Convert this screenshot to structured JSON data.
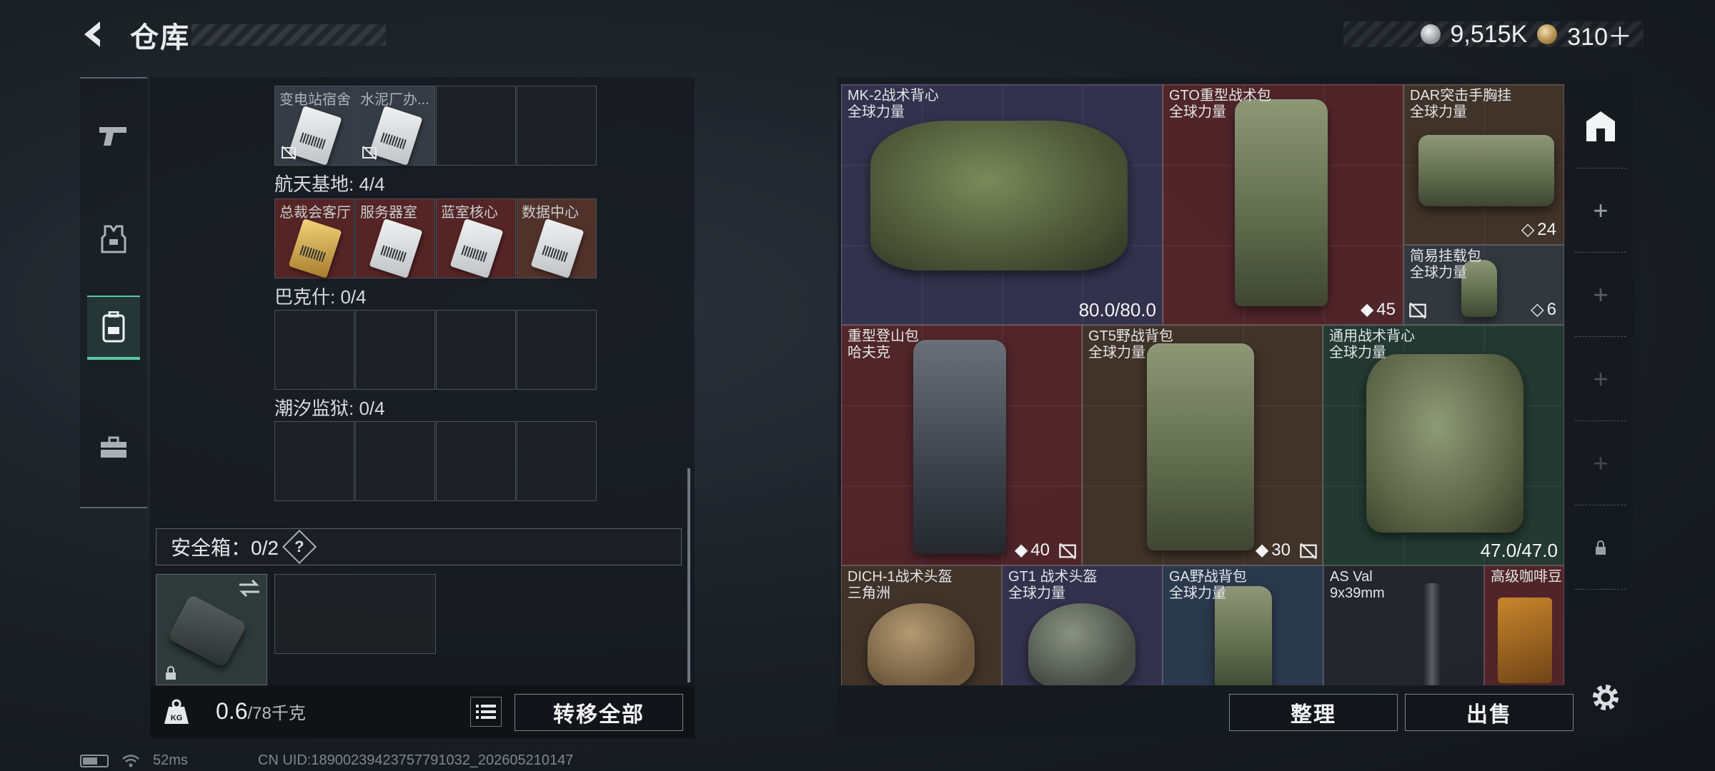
{
  "header": {
    "title": "仓库"
  },
  "currency": {
    "silver": "9,515K",
    "gold": "310＋"
  },
  "left_groups": [
    {
      "label": "",
      "slots": [
        "变电站宿舍",
        "水泥厂办...",
        "",
        ""
      ]
    },
    {
      "label": "航天基地: 4/4",
      "slots": [
        "总裁会客厅",
        "服务器室",
        "蓝室核心",
        "数据中心"
      ]
    },
    {
      "label": "巴克什: 0/4",
      "slots": [
        "",
        "",
        "",
        ""
      ]
    },
    {
      "label": "潮汐监狱: 0/4",
      "slots": [
        "",
        "",
        "",
        ""
      ]
    }
  ],
  "safebox": {
    "label": "安全箱：0/2",
    "help": "?"
  },
  "bottom_left": {
    "weight": "0.6",
    "weight_max": "/78千克",
    "transfer_all": "转移全部"
  },
  "items": [
    {
      "name": "MK-2战术背心",
      "sub": "全球力量",
      "value": "80.0/80.0"
    },
    {
      "name": "GTO重型战术包",
      "sub": "全球力量",
      "value": "45"
    },
    {
      "name": "DAR突击手胸挂",
      "sub": "全球力量",
      "value": "24"
    },
    {
      "name": "简易挂载包",
      "sub": "全球力量",
      "value": "6"
    },
    {
      "name": "重型登山包",
      "sub": "哈夫克",
      "value": "40"
    },
    {
      "name": "GT5野战背包",
      "sub": "全球力量",
      "value": "30"
    },
    {
      "name": "通用战术背心",
      "sub": "全球力量",
      "value": "47.0/47.0"
    },
    {
      "name": "DICH-1战术头盔",
      "sub": "三角洲",
      "value": ""
    },
    {
      "name": "GT1 战术头盔",
      "sub": "全球力量",
      "value": ""
    },
    {
      "name": "GA野战背包",
      "sub": "全球力量",
      "value": ""
    },
    {
      "name": "AS Val",
      "sub": "9x39mm",
      "value": ""
    },
    {
      "name": "高级咖啡豆",
      "sub": "",
      "value": ""
    }
  ],
  "bottom_right": {
    "organize": "整理",
    "sell": "出售"
  },
  "status": {
    "ping": "52ms",
    "uid": "CN UID:18900239423757791032_202605210147"
  },
  "colors": {
    "accent": "#58c9a0",
    "red_slot": "#602628",
    "purple_slot": "#3c385a"
  },
  "icons": [
    "back-arrow-icon",
    "pistol-icon",
    "armor-icon",
    "backpack-icon",
    "toolbox-icon",
    "weight-kg-icon",
    "list-icon",
    "safe-icon",
    "plus-icon",
    "lock-icon",
    "gear-icon",
    "wifi-icon",
    "battery-icon"
  ]
}
